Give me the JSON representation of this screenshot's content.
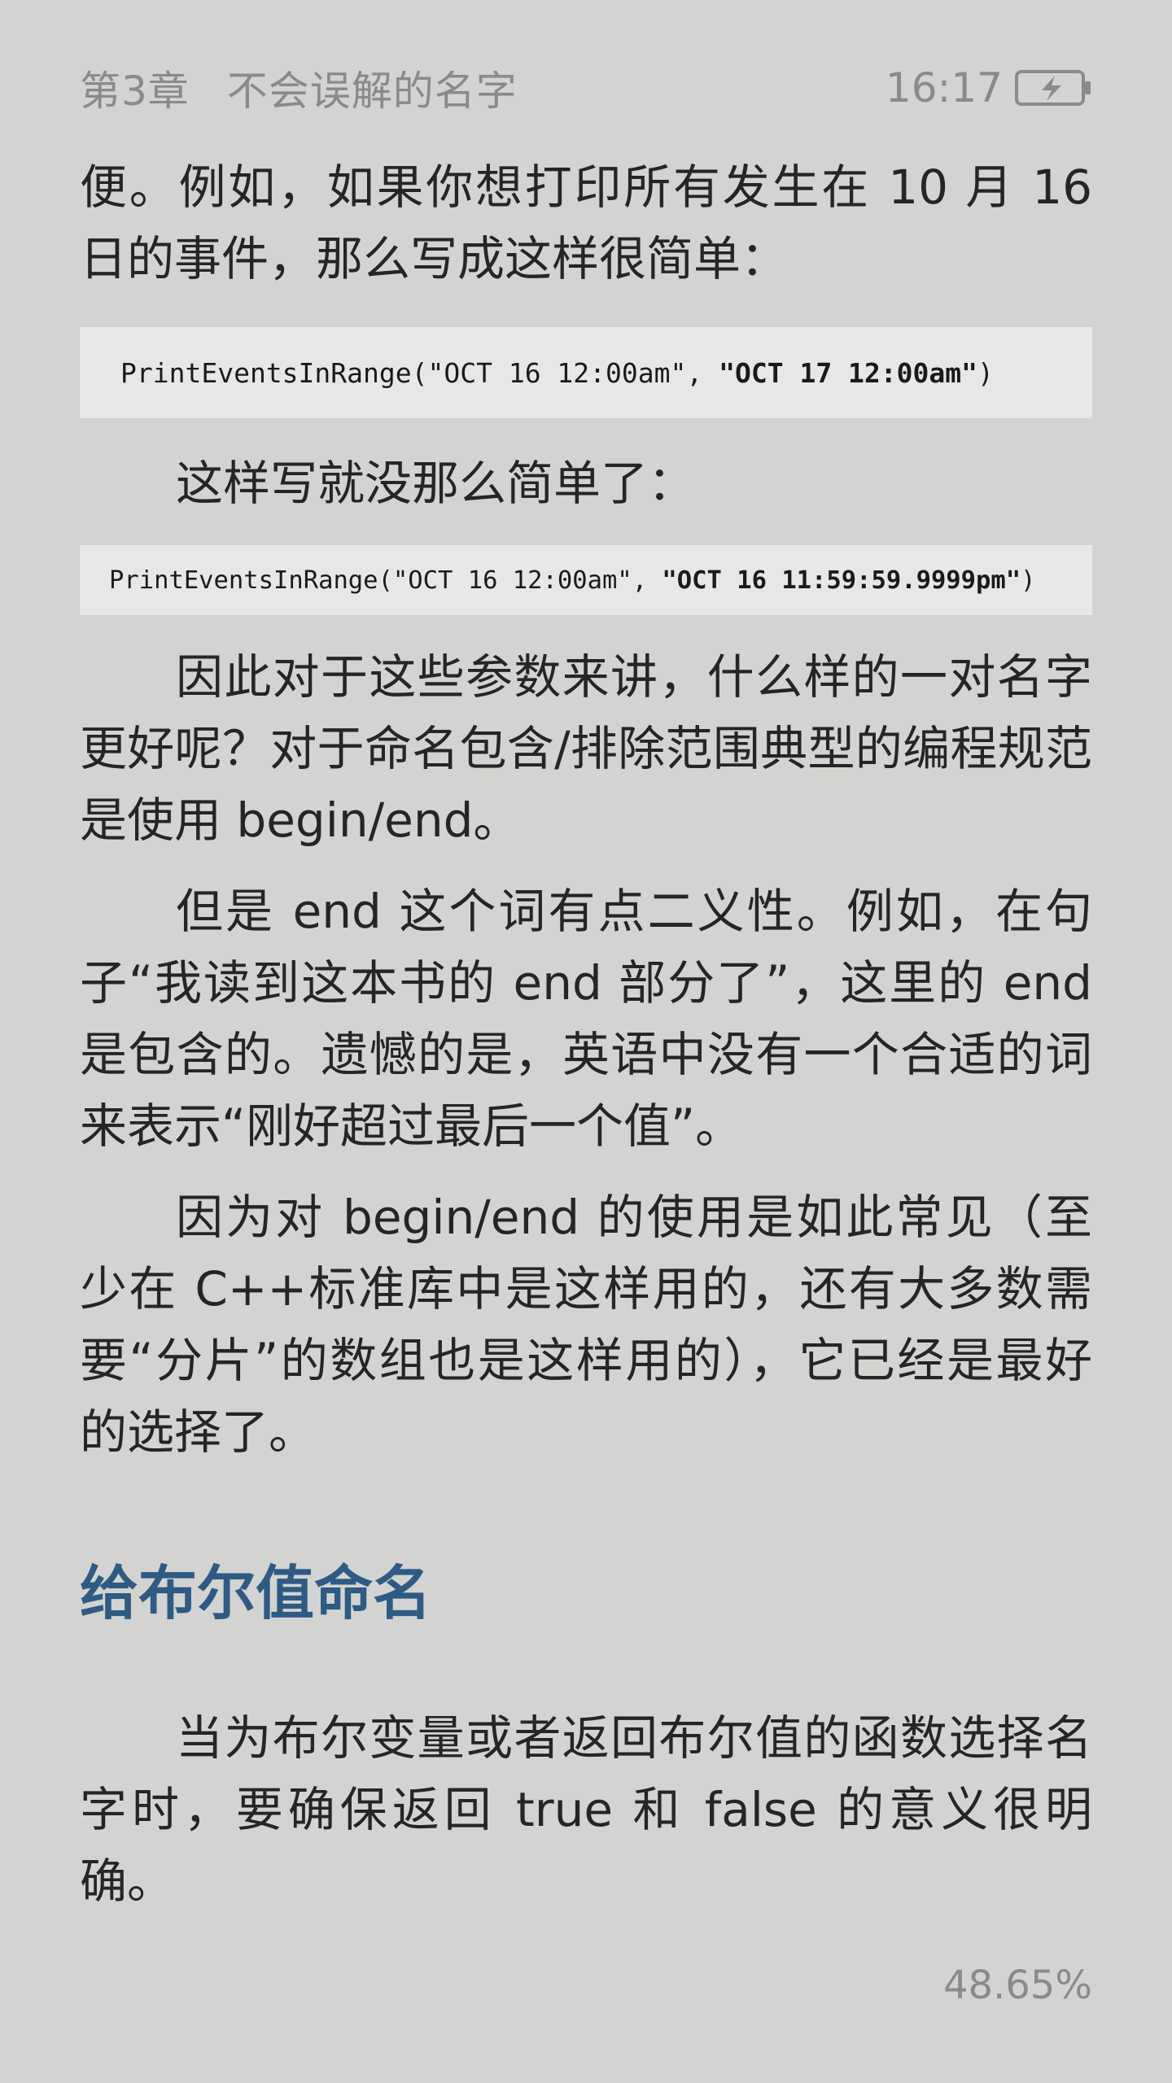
{
  "status_bar": {
    "chapter_label": "第3章",
    "chapter_name": "不会误解的名字",
    "time": "16:17",
    "battery_icon": "battery-charging-icon"
  },
  "content": {
    "para1": "便。例如，如果你想打印所有发生在 10 月 16 日的事件，那么写成这样很简单：",
    "code1": {
      "prefix": "PrintEventsInRange(\"OCT 16 12:00am\", ",
      "strong": "\"OCT 17 12:00am\"",
      "suffix": ")"
    },
    "para2": "这样写就没那么简单了：",
    "code2": {
      "prefix": "PrintEventsInRange(\"OCT 16 12:00am\", ",
      "strong": "\"OCT 16 11:59:59.9999pm\"",
      "suffix": ")"
    },
    "para3": "因此对于这些参数来讲，什么样的一对名字更好呢？对于命名包含/排除范围典型的编程规范是使用 begin/end。",
    "para4": "但是 end 这个词有点二义性。例如，在句子“我读到这本书的 end 部分了”，这里的 end 是包含的。遗憾的是，英语中没有一个合适的词来表示“刚好超过最后一个值”。",
    "para5": "因为对 begin/end 的使用是如此常见（至少在 C++标准库中是这样用的，还有大多数需要“分片”的数组也是这样用的），它已经是最好的选择了。",
    "section_heading": "给布尔值命名",
    "para6": "当为布尔变量或者返回布尔值的函数选择名字时，要确保返回 true 和 false 的意义很明确。"
  },
  "footer": {
    "progress_text": "48.65%"
  },
  "colors": {
    "background": "#d3d4d1",
    "heading": "#2e5a84",
    "muted": "#8a8a8a",
    "code_background": "#e7e8e6"
  }
}
